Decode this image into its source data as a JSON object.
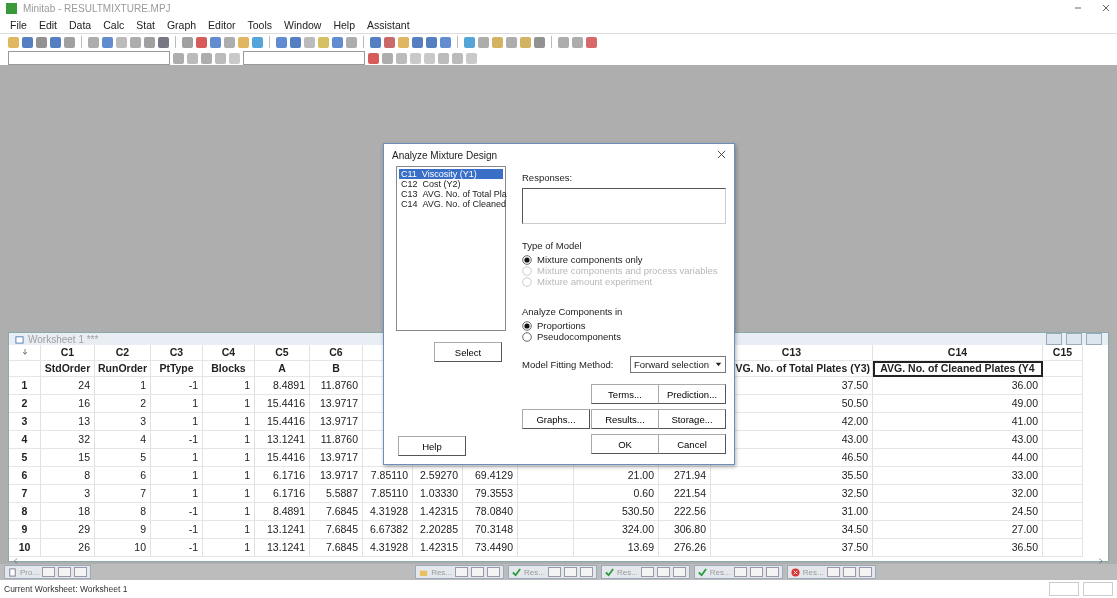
{
  "window": {
    "title": "Minitab - RESULTMIXTURE.MPJ"
  },
  "menu": [
    "File",
    "Edit",
    "Data",
    "Calc",
    "Stat",
    "Graph",
    "Editor",
    "Tools",
    "Window",
    "Help",
    "Assistant"
  ],
  "worksheet": {
    "title": "Worksheet 1 ***",
    "columns": [
      {
        "id": "C1",
        "name": "StdOrder",
        "selected": false
      },
      {
        "id": "C2",
        "name": "RunOrder",
        "selected": false
      },
      {
        "id": "C3",
        "name": "PtType",
        "selected": false
      },
      {
        "id": "C4",
        "name": "Blocks",
        "selected": false
      },
      {
        "id": "C5",
        "name": "A",
        "selected": false
      },
      {
        "id": "C6",
        "name": "B",
        "selected": false
      },
      {},
      {},
      {},
      {},
      {},
      {},
      {
        "id": "C13",
        "name": "VG. No. of Total Plates (Y3)",
        "selected": false
      },
      {
        "id": "C14",
        "name": "AVG. No. of Cleaned Plates (Y4",
        "selected": true
      },
      {
        "id": "C15",
        "selected": false
      }
    ],
    "rows": [
      {
        "number": "1",
        "cells": [
          "24",
          "1",
          "-1",
          "1",
          "8.4891",
          "11.8760",
          null,
          null,
          null,
          null,
          null,
          null,
          "37.50",
          "36.00",
          null
        ]
      },
      {
        "number": "2",
        "cells": [
          "16",
          "2",
          "1",
          "1",
          "15.4416",
          "13.9717",
          null,
          null,
          null,
          null,
          null,
          null,
          "50.50",
          "49.00",
          null
        ]
      },
      {
        "number": "3",
        "cells": [
          "13",
          "3",
          "1",
          "1",
          "15.4416",
          "13.9717",
          null,
          null,
          null,
          null,
          null,
          null,
          "42.00",
          "41.00",
          null
        ]
      },
      {
        "number": "4",
        "cells": [
          "32",
          "4",
          "-1",
          "1",
          "13.1241",
          "11.8760",
          null,
          null,
          null,
          null,
          null,
          null,
          "43.00",
          "43.00",
          null
        ]
      },
      {
        "number": "5",
        "cells": [
          "15",
          "5",
          "1",
          "1",
          "15.4416",
          "13.9717",
          null,
          null,
          null,
          null,
          null,
          null,
          "46.50",
          "44.00",
          null
        ]
      },
      {
        "number": "6",
        "cells": [
          "8",
          "6",
          "1",
          "1",
          "6.1716",
          "13.9717",
          "7.85110",
          "2.59270",
          "69.4129",
          null,
          "21.00",
          "271.94",
          "35.50",
          "33.00",
          null
        ]
      },
      {
        "number": "7",
        "cells": [
          "3",
          "7",
          "1",
          "1",
          "6.1716",
          "5.5887",
          "7.85110",
          "1.03330",
          "79.3553",
          null,
          "0.60",
          "221.54",
          "32.50",
          "32.00",
          null
        ]
      },
      {
        "number": "8",
        "cells": [
          "18",
          "8",
          "-1",
          "1",
          "8.4891",
          "7.6845",
          "4.31928",
          "1.42315",
          "78.0840",
          null,
          "530.50",
          "222.56",
          "31.00",
          "24.50",
          null
        ]
      },
      {
        "number": "9",
        "cells": [
          "29",
          "9",
          "-1",
          "1",
          "13.1241",
          "7.6845",
          "6.67382",
          "2.20285",
          "70.3148",
          null,
          "324.00",
          "306.80",
          "34.50",
          "27.00",
          null
        ]
      },
      {
        "number": "10",
        "cells": [
          "26",
          "10",
          "-1",
          "1",
          "13.1241",
          "7.6845",
          "4.31928",
          "1.42315",
          "73.4490",
          null,
          "13.69",
          "276.26",
          "37.50",
          "36.50",
          null
        ]
      }
    ]
  },
  "minimized_windows": [
    {
      "kind": "project",
      "label": "Pro..."
    },
    {
      "kind": "session",
      "label": "Res..."
    },
    {
      "kind": "check",
      "label": "Res..."
    },
    {
      "kind": "check",
      "label": "Res..."
    },
    {
      "kind": "check",
      "label": "Res..."
    },
    {
      "kind": "error",
      "label": "Res..."
    }
  ],
  "status_bar": {
    "text": "Current Worksheet: Worksheet 1"
  },
  "dialog": {
    "title": "Analyze Mixture Design",
    "variables": [
      {
        "id": "C11",
        "name": "Viscosity (Y1)",
        "selected": true
      },
      {
        "id": "C12",
        "name": "Cost (Y2)",
        "selected": false
      },
      {
        "id": "C13",
        "name": "AVG. No. of Total Pla",
        "selected": false
      },
      {
        "id": "C14",
        "name": "AVG. No. of Cleaned",
        "selected": false
      }
    ],
    "select_button": "Select",
    "responses": {
      "label": "Responses:"
    },
    "model_type": {
      "label": "Type of Model",
      "options": [
        {
          "label": "Mixture components only",
          "selected": true,
          "disabled": false
        },
        {
          "label": "Mixture components and process variables",
          "selected": false,
          "disabled": true
        },
        {
          "label": "Mixture amount experiment",
          "selected": false,
          "disabled": true
        }
      ]
    },
    "components": {
      "label": "Analyze Components in",
      "options": [
        {
          "label": "Proportions",
          "selected": true,
          "disabled": false
        },
        {
          "label": "Pseudocomponents",
          "selected": false,
          "disabled": false
        }
      ]
    },
    "fitting": {
      "label": "Model Fitting Method:",
      "value": "Forward selection"
    },
    "buttons": {
      "terms": "Terms...",
      "prediction": "Prediction...",
      "graphs": "Graphs...",
      "results": "Results...",
      "storage": "Storage...",
      "help": "Help",
      "ok": "OK",
      "cancel": "Cancel"
    }
  }
}
